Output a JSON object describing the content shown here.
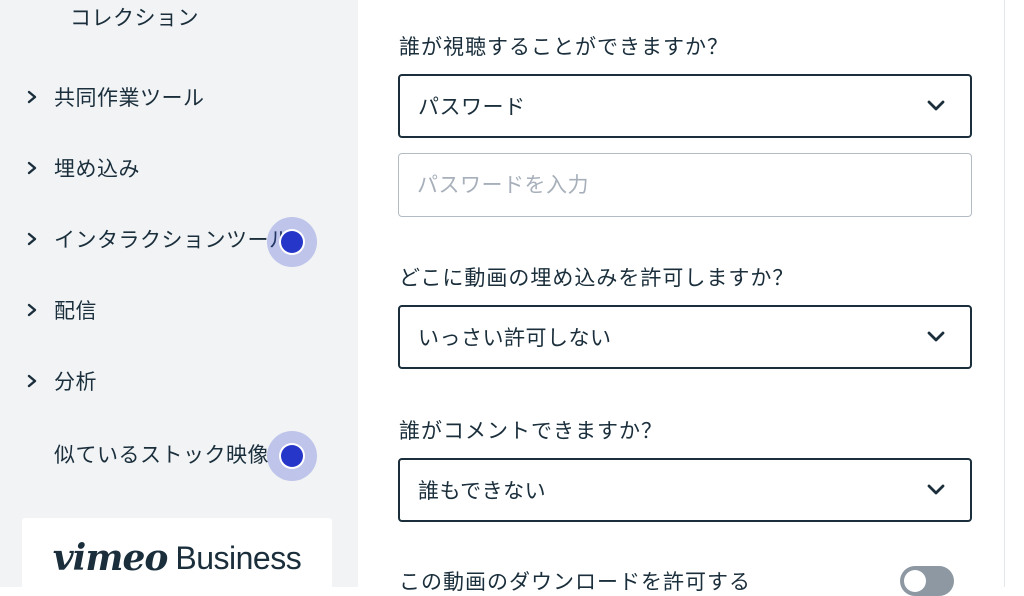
{
  "sidebar": {
    "collection_label": "コレクション",
    "items": [
      {
        "label": "共同作業ツール"
      },
      {
        "label": "埋め込み"
      },
      {
        "label": "インタラクションツール"
      },
      {
        "label": "配信"
      },
      {
        "label": "分析"
      }
    ],
    "stock_label": "似ているストック映像",
    "brand": {
      "vimeo": "vimeo",
      "business": "Business"
    }
  },
  "settings": {
    "who_can_view": {
      "question": "誰が視聴することができますか？",
      "value": "パスワード"
    },
    "password": {
      "placeholder": "パスワードを入力",
      "value": ""
    },
    "embed": {
      "question": "どこに動画の埋め込みを許可しますか？",
      "value": "いっさい許可しない"
    },
    "comments": {
      "question": "誰がコメントできますか？",
      "value": "誰もできない"
    },
    "download": {
      "label": "この動画のダウンロードを許可する",
      "enabled": false
    }
  },
  "colors": {
    "text": "#1a2e3b",
    "sidebar_bg": "#f1f3f5",
    "hotspot": "#2536c8",
    "toggle_off": "#8d98a3"
  },
  "icons": {
    "expand": "chevron-right-icon",
    "dropdown": "chevron-down-icon"
  }
}
